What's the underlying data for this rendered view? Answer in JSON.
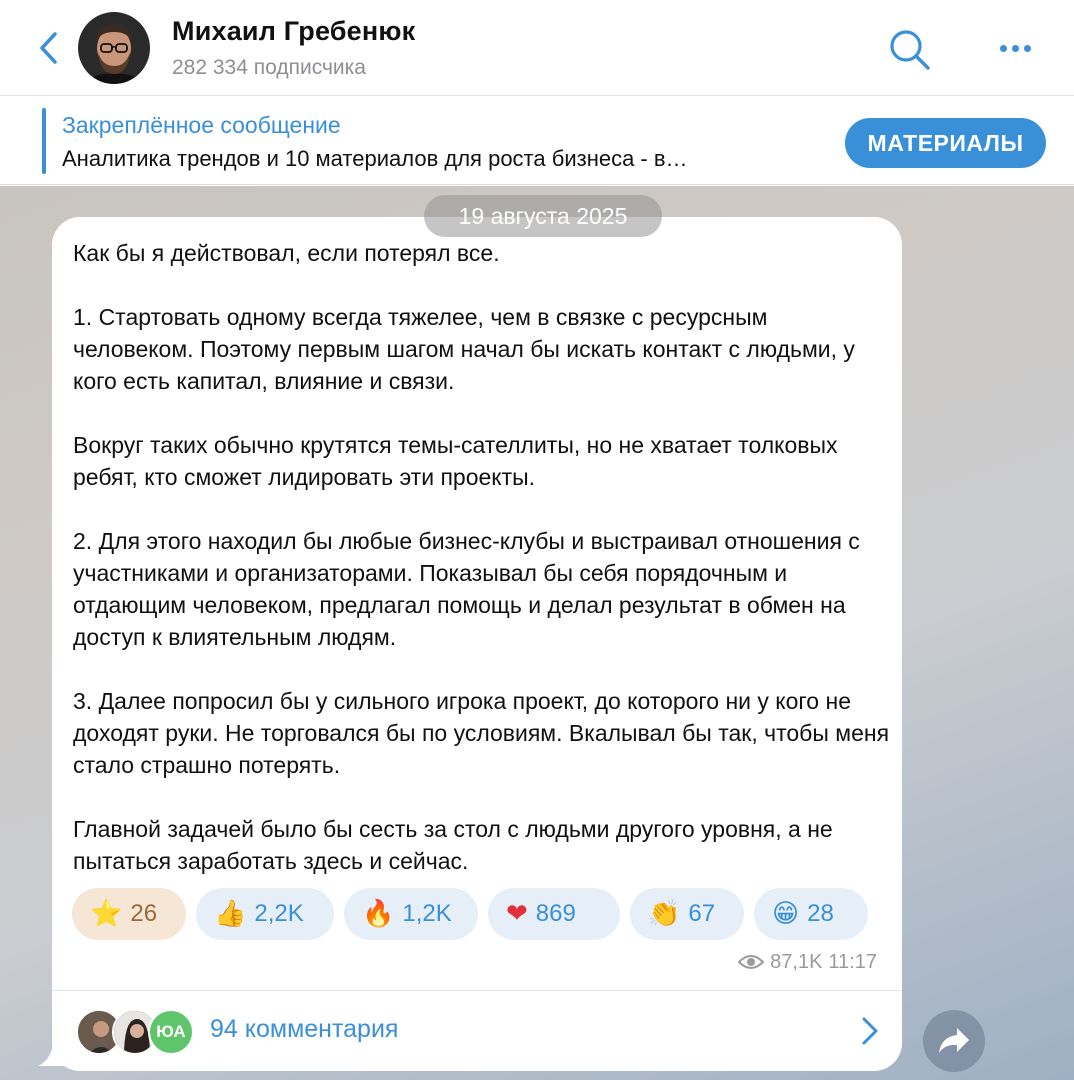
{
  "header": {
    "title": "Михаил Гребенюк",
    "subtitle": "282 334 подписчика"
  },
  "pinned": {
    "title": "Закреплённое сообщение",
    "text": "Аналитика трендов и 10 материалов для роста бизнеса - в…",
    "button_label": "МАТЕРИАЛЫ"
  },
  "date_label": "19 августа 2025",
  "post": {
    "paragraphs": [
      "Как бы я действовал, если потерял все.",
      "1. Стартовать одному всегда тяжелее, чем в связке с ресурсным человеком. Поэтому первым шагом начал бы искать контакт с людьми, у кого есть капитал, влияние и связи.",
      "Вокруг таких обычно крутятся темы-сателлиты, но не хватает толковых ребят, кто сможет лидировать эти проекты.",
      "2. Для этого находил бы любые бизнес-клубы и выстраивал отношения с участниками и организаторами. Показывал бы себя порядочным и отдающим человеком, предлагал помощь и делал результат в обмен на доступ к влиятельным людям.",
      "3. Далее попросил бы у сильного игрока проект, до которого ни у кого не доходят руки. Не торговался бы по условиям. Вкалывал бы так, чтобы меня стало страшно потерять.",
      "Главной задачей было бы сесть за стол с людьми другого уровня, а не пытаться заработать здесь и сейчас."
    ],
    "reactions": [
      {
        "emoji": "⭐",
        "icon": "star-icon",
        "count": "26"
      },
      {
        "emoji": "👍",
        "icon": "thumbs-up-icon",
        "count": "2,2K"
      },
      {
        "emoji": "🔥",
        "icon": "fire-icon",
        "count": "1,2K"
      },
      {
        "emoji": "❤",
        "icon": "heart-icon",
        "count": "869"
      },
      {
        "emoji": "👏",
        "icon": "clap-icon",
        "count": "67"
      },
      {
        "emoji": "😁",
        "icon": "grin-icon",
        "count": "28"
      }
    ],
    "views": "87,1K",
    "time": "11:17",
    "comments_label": "94 комментария",
    "comment_avatar_initials": "ЮА"
  },
  "colors": {
    "accent": "#3a8fd9",
    "star_reaction_bg": "#f5e6d6",
    "reaction_bg": "#e6eef7"
  }
}
